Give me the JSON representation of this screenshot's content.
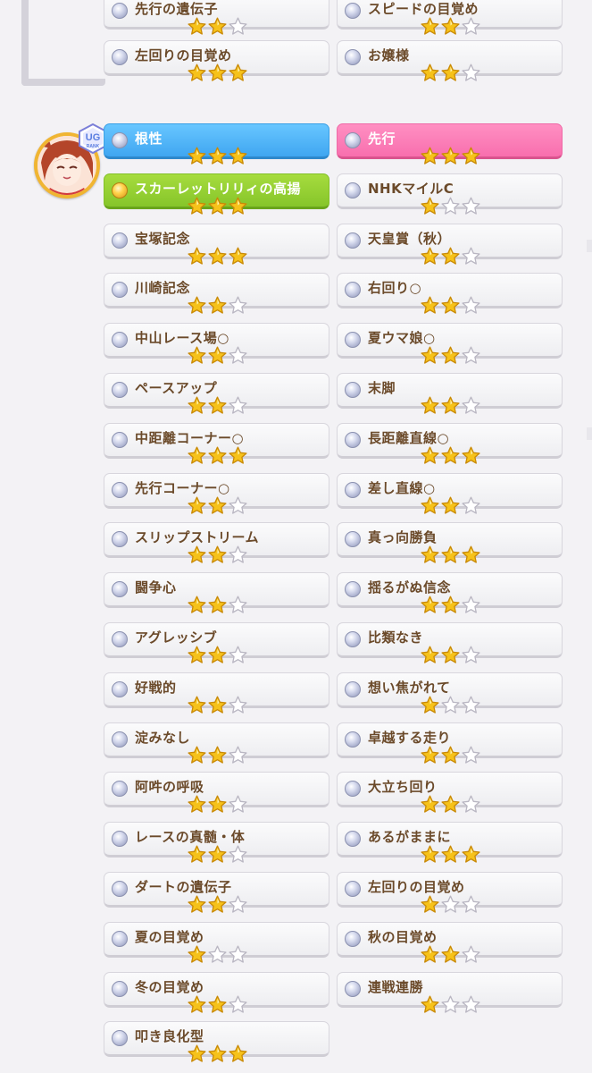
{
  "character": {
    "rank_badge": "UG",
    "rank_label": "RANK"
  },
  "skills_top": [
    {
      "left": {
        "name": "先行の遺伝子",
        "stars": 2
      },
      "right": {
        "name": "スピードの目覚め",
        "stars": 2
      }
    },
    {
      "left": {
        "name": "左回りの目覚め",
        "stars": 3
      },
      "right": {
        "name": "お嬢様",
        "stars": 2
      }
    }
  ],
  "skills_main": [
    {
      "left": {
        "name": "根性",
        "stars": 3,
        "style": "blue"
      },
      "right": {
        "name": "先行",
        "stars": 3,
        "style": "pink"
      }
    },
    {
      "left": {
        "name": "スカーレットリリィの高揚",
        "stars": 3,
        "style": "green"
      },
      "right": {
        "name": "NHKマイルC",
        "stars": 1,
        "style": "plain"
      }
    },
    {
      "left": {
        "name": "宝塚記念",
        "stars": 3,
        "style": "plain"
      },
      "right": {
        "name": "天皇賞（秋）",
        "stars": 2,
        "style": "plain"
      }
    },
    {
      "left": {
        "name": "川崎記念",
        "stars": 2,
        "style": "plain"
      },
      "right": {
        "name": "右回り○",
        "stars": 2,
        "style": "plain"
      }
    },
    {
      "left": {
        "name": "中山レース場○",
        "stars": 2,
        "style": "plain"
      },
      "right": {
        "name": "夏ウマ娘○",
        "stars": 2,
        "style": "plain"
      }
    },
    {
      "left": {
        "name": "ペースアップ",
        "stars": 2,
        "style": "plain"
      },
      "right": {
        "name": "末脚",
        "stars": 2,
        "style": "plain"
      }
    },
    {
      "left": {
        "name": "中距離コーナー○",
        "stars": 3,
        "style": "plain"
      },
      "right": {
        "name": "長距離直線○",
        "stars": 3,
        "style": "plain"
      }
    },
    {
      "left": {
        "name": "先行コーナー○",
        "stars": 2,
        "style": "plain"
      },
      "right": {
        "name": "差し直線○",
        "stars": 2,
        "style": "plain"
      }
    },
    {
      "left": {
        "name": "スリップストリーム",
        "stars": 2,
        "style": "plain"
      },
      "right": {
        "name": "真っ向勝負",
        "stars": 3,
        "style": "plain"
      }
    },
    {
      "left": {
        "name": "闘争心",
        "stars": 2,
        "style": "plain"
      },
      "right": {
        "name": "揺るがぬ信念",
        "stars": 2,
        "style": "plain"
      }
    },
    {
      "left": {
        "name": "アグレッシブ",
        "stars": 2,
        "style": "plain"
      },
      "right": {
        "name": "比類なき",
        "stars": 2,
        "style": "plain"
      }
    },
    {
      "left": {
        "name": "好戦的",
        "stars": 2,
        "style": "plain"
      },
      "right": {
        "name": "想い焦がれて",
        "stars": 1,
        "style": "plain"
      }
    },
    {
      "left": {
        "name": "淀みなし",
        "stars": 2,
        "style": "plain"
      },
      "right": {
        "name": "卓越する走り",
        "stars": 2,
        "style": "plain"
      }
    },
    {
      "left": {
        "name": "阿吽の呼吸",
        "stars": 2,
        "style": "plain"
      },
      "right": {
        "name": "大立ち回り",
        "stars": 2,
        "style": "plain"
      }
    },
    {
      "left": {
        "name": "レースの真髄・体",
        "stars": 2,
        "style": "plain"
      },
      "right": {
        "name": "あるがままに",
        "stars": 3,
        "style": "plain"
      }
    },
    {
      "left": {
        "name": "ダートの遺伝子",
        "stars": 2,
        "style": "plain"
      },
      "right": {
        "name": "左回りの目覚め",
        "stars": 1,
        "style": "plain"
      }
    },
    {
      "left": {
        "name": "夏の目覚め",
        "stars": 1,
        "style": "plain"
      },
      "right": {
        "name": "秋の目覚め",
        "stars": 2,
        "style": "plain"
      }
    },
    {
      "left": {
        "name": "冬の目覚め",
        "stars": 2,
        "style": "plain"
      },
      "right": {
        "name": "連戦連勝",
        "stars": 1,
        "style": "plain"
      }
    },
    {
      "left": {
        "name": "叩き良化型",
        "stars": 3,
        "style": "plain"
      },
      "right": null
    }
  ],
  "colors": {
    "star_filled": "#f6c21a",
    "star_empty": "#ffffff",
    "text_brown": "#6b4a2a"
  }
}
